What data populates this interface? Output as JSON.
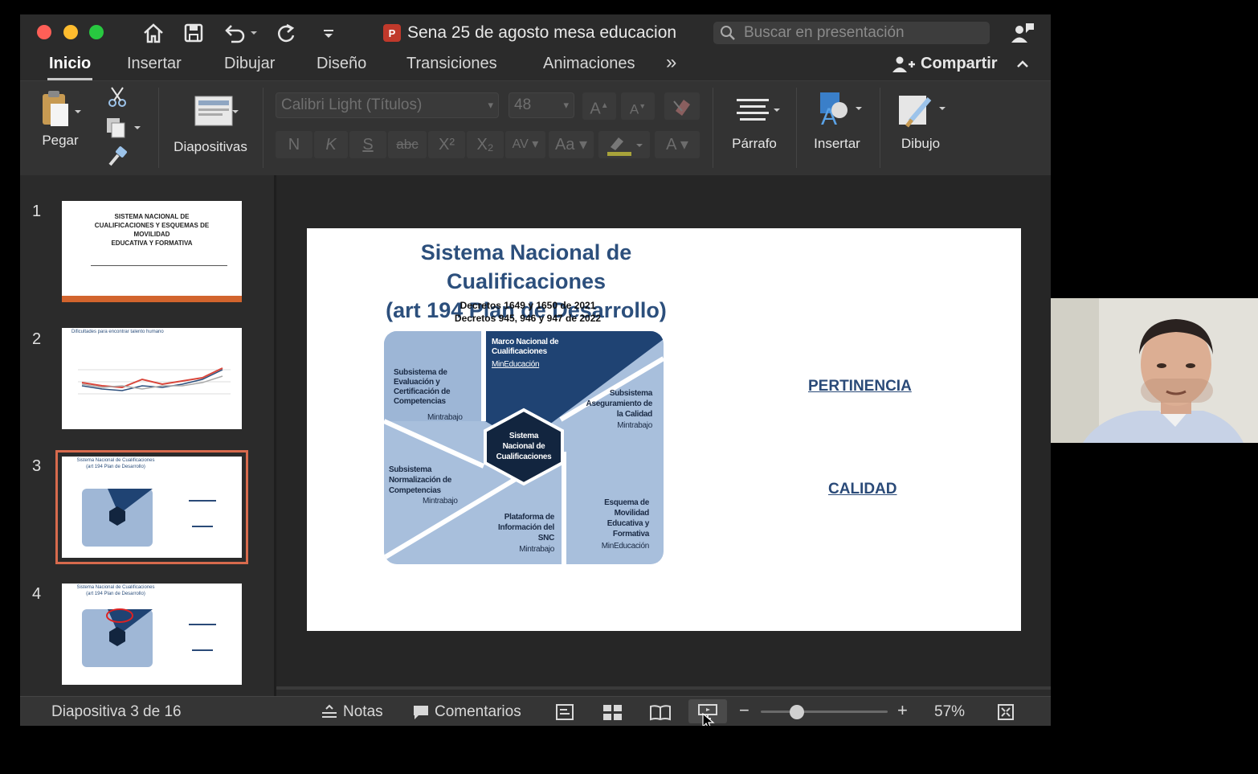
{
  "window": {
    "title": "Sena 25 de agosto mesa educacion",
    "search_placeholder": "Buscar en presentación"
  },
  "tabs": [
    "Inicio",
    "Insertar",
    "Dibujar",
    "Diseño",
    "Transiciones",
    "Animaciones"
  ],
  "tabs_more": "»",
  "share_label": "Compartir",
  "ribbon": {
    "paste": "Pegar",
    "slides": "Diapositivas",
    "font_name": "Calibri Light (Títulos)",
    "font_size": "48",
    "bold": "N",
    "italic": "K",
    "underline": "S",
    "strike": "abc",
    "superscript": "X²",
    "subscript": "X₂",
    "spacing": "AV",
    "case": "Aa",
    "grow": "A",
    "shrink": "A",
    "color_a": "A",
    "paragraph": "Párrafo",
    "insert": "Insertar",
    "draw": "Dibujo"
  },
  "thumbnails": [
    {
      "number": "1",
      "lines": [
        "SISTEMA NACIONAL DE",
        "CUALIFICACIONES Y ESQUEMAS DE",
        "MOVILIDAD",
        "EDUCATIVA Y FORMATIVA"
      ]
    },
    {
      "number": "2",
      "title": "Dificultades para encontrar talento humano"
    },
    {
      "number": "3",
      "title": "Sistema Nacional de Cualificaciones",
      "subtitle": "(art 194 Plan de Desarrollo)"
    },
    {
      "number": "4",
      "title": "Sistema Nacional de Cualificaciones",
      "subtitle": "(art 194 Plan de Desarrollo)"
    }
  ],
  "slide": {
    "title_line1": "Sistema Nacional de Cualificaciones",
    "title_line2": "(art 194 Plan de Desarrollo)",
    "decree_line1": "Decretos 1649 y 1650  de 2021",
    "decree_line2": "Decretos 945, 946 y 947 de 2022",
    "center": [
      "Sistema",
      "Nacional de",
      "Cualificaciones"
    ],
    "segments": {
      "marco": {
        "lines": [
          "Marco Nacional de",
          "Cualificaciones"
        ],
        "owner": "MinEducación"
      },
      "evaluacion": {
        "lines": [
          "Subsistema de",
          "Evaluación y",
          "Certificación de",
          "Competencias"
        ],
        "owner": "Mintrabajo"
      },
      "aseguramiento": {
        "lines": [
          "Subsistema",
          "Aseguramiento de",
          "la Calidad"
        ],
        "owner": "Mintrabajo"
      },
      "normalizacion": {
        "lines": [
          "Subsistema",
          "Normalización de",
          "Competencias"
        ],
        "owner": "Mintrabajo"
      },
      "plataforma": {
        "lines": [
          "Plataforma de",
          "Información del",
          "SNC"
        ],
        "owner": "Mintrabajo"
      },
      "movilidad": {
        "lines": [
          "Esquema de",
          "Movilidad",
          "Educativa y",
          "Formativa"
        ],
        "owner": "MinEducación"
      }
    },
    "keyword1": "PERTINENCIA",
    "keyword2": "CALIDAD"
  },
  "status": {
    "slide_counter": "Diapositiva 3 de 16",
    "notes": "Notas",
    "comments": "Comentarios",
    "zoom": "57%",
    "zoom_minus": "−",
    "zoom_plus": "+"
  },
  "colors": {
    "accent_selection": "#d76a4d",
    "slide_title": "#2c4f7c",
    "diagram_dark": "#1f4373",
    "diagram_light": "#9fb7d6",
    "diagram_center": "#12253f"
  }
}
